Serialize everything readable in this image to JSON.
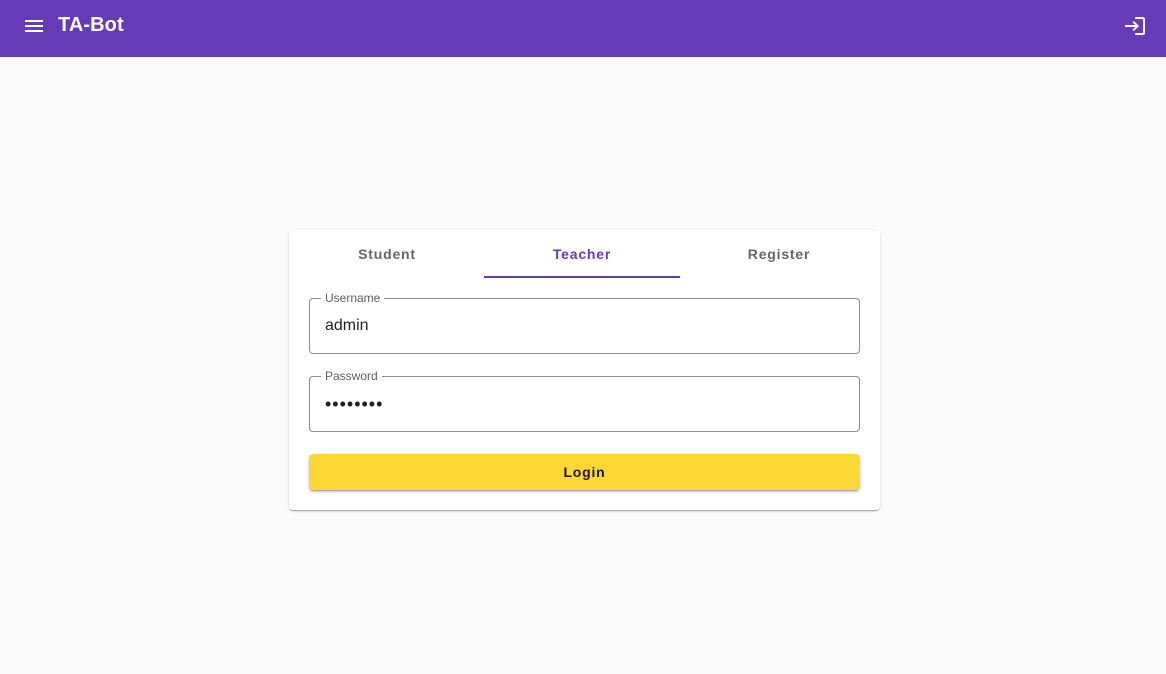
{
  "app": {
    "title": "TA-Bot"
  },
  "colors": {
    "primary": "#673ab7",
    "accent": "#fdd835",
    "background": "#fafafa"
  },
  "icons": {
    "menu": "menu-icon",
    "login": "login-icon"
  },
  "tabs": [
    {
      "label": "Student",
      "selected": false
    },
    {
      "label": "Teacher",
      "selected": true
    },
    {
      "label": "Register",
      "selected": false
    }
  ],
  "form": {
    "username": {
      "label": "Username",
      "value": "admin"
    },
    "password": {
      "label": "Password",
      "value": "••••••••"
    },
    "submit_label": "Login"
  }
}
